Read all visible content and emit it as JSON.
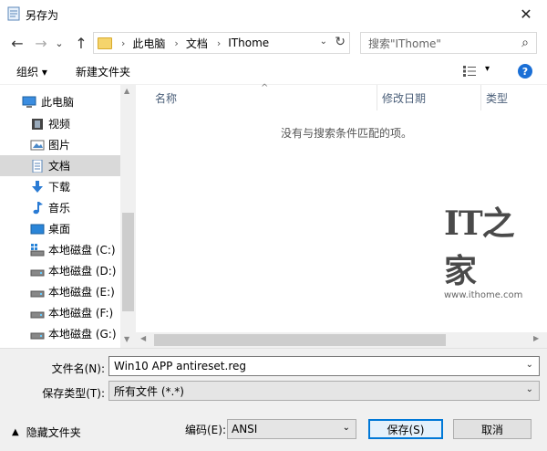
{
  "window": {
    "title": "另存为",
    "close": "✕"
  },
  "nav": {
    "back": "←",
    "forward": "→",
    "recent": "⌄",
    "up": "↑",
    "breadcrumb": [
      "此电脑",
      "文档",
      "IThome"
    ],
    "breadcrumb_sep": "›",
    "refresh": "↻",
    "search_placeholder": "搜索\"IThome\""
  },
  "toolbar": {
    "organize": "组织 ▾",
    "new_folder": "新建文件夹",
    "help": "?"
  },
  "sidebar": {
    "items": [
      {
        "label": "此电脑",
        "icon": "computer-icon"
      },
      {
        "label": "视频",
        "icon": "video-icon"
      },
      {
        "label": "图片",
        "icon": "picture-icon"
      },
      {
        "label": "文档",
        "icon": "document-icon",
        "selected": true
      },
      {
        "label": "下载",
        "icon": "download-icon"
      },
      {
        "label": "音乐",
        "icon": "music-icon"
      },
      {
        "label": "桌面",
        "icon": "desktop-icon"
      },
      {
        "label": "本地磁盘 (C:)",
        "icon": "drive-windows-icon"
      },
      {
        "label": "本地磁盘 (D:)",
        "icon": "drive-icon"
      },
      {
        "label": "本地磁盘 (E:)",
        "icon": "drive-icon"
      },
      {
        "label": "本地磁盘 (F:)",
        "icon": "drive-icon"
      },
      {
        "label": "本地磁盘 (G:)",
        "icon": "drive-icon"
      }
    ]
  },
  "filelist": {
    "columns": [
      "名称",
      "修改日期",
      "类型"
    ],
    "empty_message": "没有与搜索条件匹配的项。"
  },
  "watermark": {
    "logo": "IT之家",
    "url": "www.ithome.com"
  },
  "form": {
    "filename_label": "文件名(N):",
    "filename_value": "Win10 APP antireset.reg",
    "filetype_label": "保存类型(T):",
    "filetype_value": "所有文件  (*.*)",
    "hide_folders": "隐藏文件夹",
    "encoding_label": "编码(E):",
    "encoding_value": "ANSI",
    "save": "保存(S)",
    "cancel": "取消"
  },
  "colors": {
    "accent": "#0078d7",
    "selected_bg": "#d9d9d9",
    "help_blue": "#1a6fd6"
  }
}
